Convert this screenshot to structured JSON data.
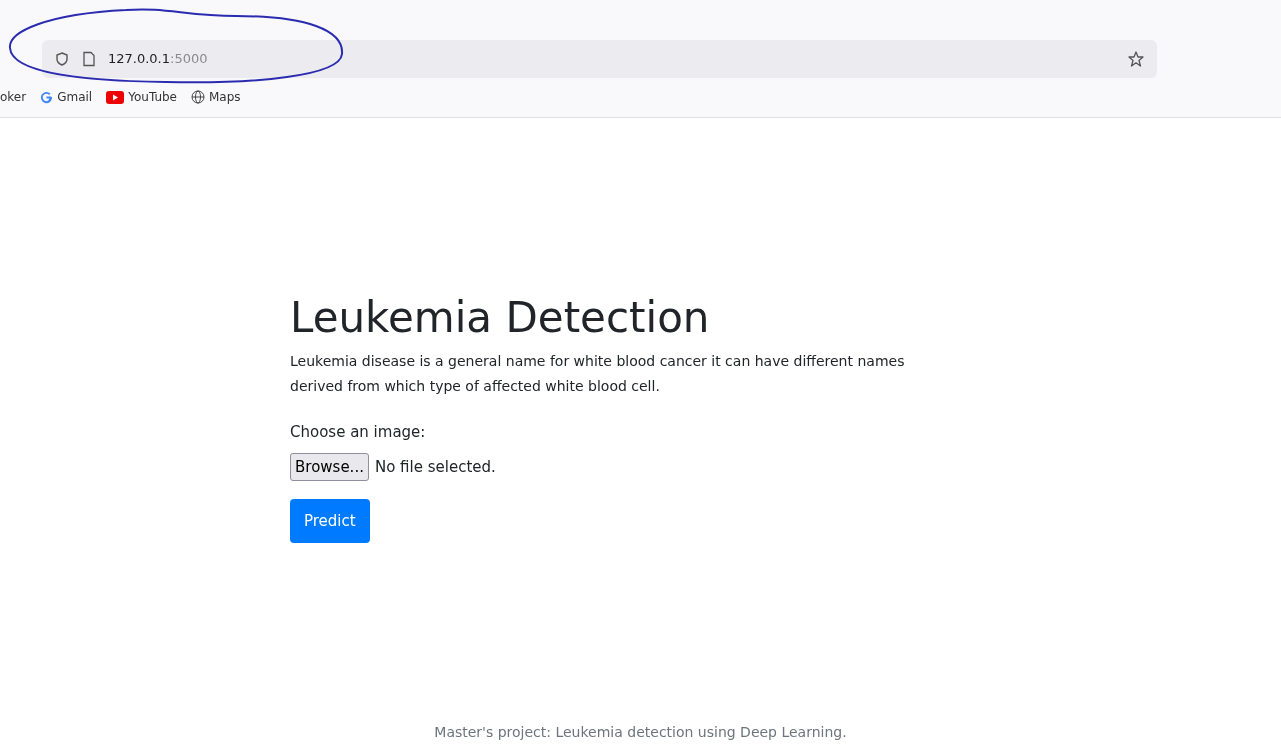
{
  "browser": {
    "url_host": "127.0.0.1",
    "url_port": ":5000",
    "bookmarks": [
      {
        "kind": "none",
        "label": "oker"
      },
      {
        "kind": "google",
        "label": "Gmail"
      },
      {
        "kind": "youtube",
        "label": "YouTube"
      },
      {
        "kind": "globe",
        "label": "Maps"
      }
    ]
  },
  "page": {
    "title": "Leukemia Detection",
    "description": "Leukemia disease is a general name for white blood cancer it can have different names derived from which type of affected white blood cell.",
    "file_label": "Choose an image:",
    "browse_button": "Browse...",
    "file_status": "No file selected.",
    "submit_button": "Predict",
    "footer": "Master's project: Leukemia detection using Deep Learning."
  }
}
